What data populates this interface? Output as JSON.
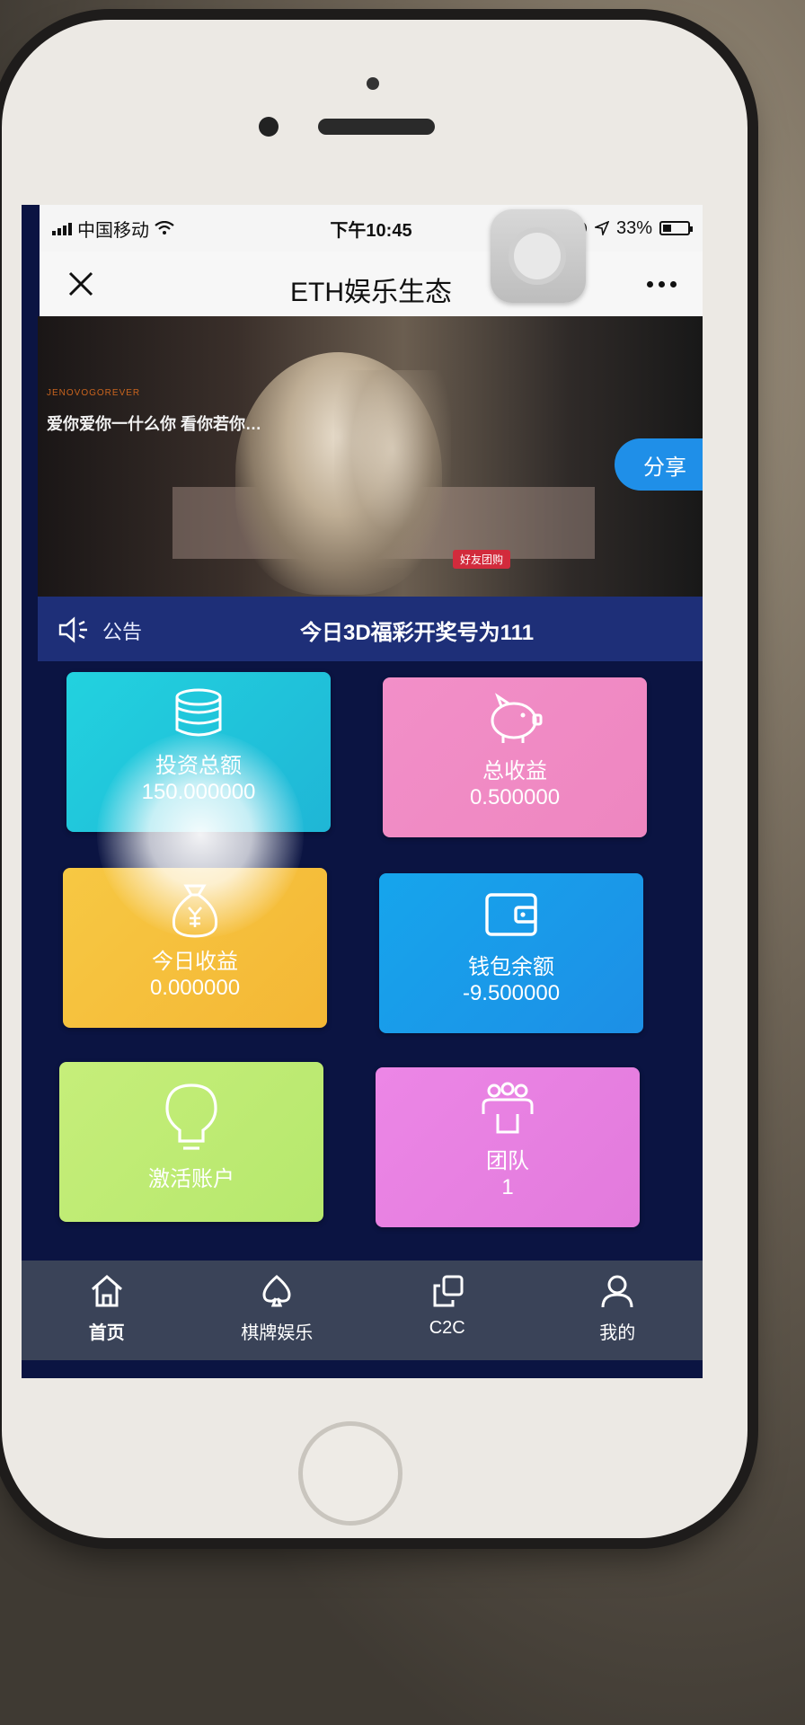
{
  "status_bar": {
    "carrier": "中国移动",
    "time": "下午10:45",
    "battery": "33%"
  },
  "nav": {
    "title": "ETH娱乐生态"
  },
  "banner": {
    "small_text": "JENOVOGOREVER",
    "slogan": "爱你爱你一什么你 看你若你…",
    "tag": "好友团购"
  },
  "share_label": "分享",
  "notice": {
    "label": "公告",
    "message": "今日3D福彩开奖号为111"
  },
  "cards": {
    "investment_total": {
      "label": "投资总额",
      "value": "150.000000",
      "icon": "coins-icon"
    },
    "total_income": {
      "label": "总收益",
      "value": "0.500000",
      "icon": "piggy-bank-icon"
    },
    "today_income": {
      "label": "今日收益",
      "value": "0.000000",
      "icon": "money-bag-icon"
    },
    "wallet_balance": {
      "label": "钱包余额",
      "value": "-9.500000",
      "icon": "wallet-icon"
    },
    "activate_account": {
      "label": "激活账户",
      "icon": "lightbulb-icon"
    },
    "team": {
      "label": "团队",
      "value": "1",
      "icon": "team-icon"
    }
  },
  "tabs": {
    "home": "首页",
    "games": "棋牌娱乐",
    "c2c": "C2C",
    "mine": "我的"
  },
  "colors": {
    "screen_bg": "#0b1442",
    "notice_bg": "#1e2f78",
    "tabbar_bg": "#3a4358",
    "share_bg": "#1f8fe8"
  }
}
